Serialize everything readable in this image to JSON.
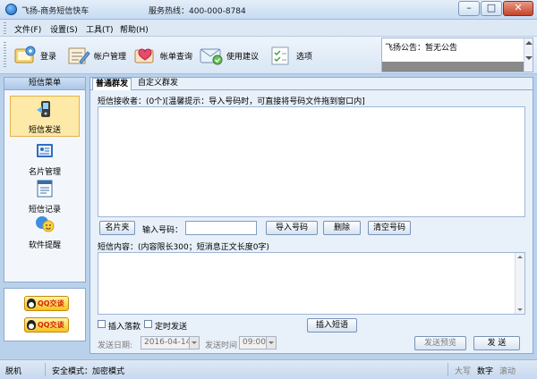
{
  "window": {
    "title": "飞扬-商务短信快车",
    "hotline": "服务热线：400-000-8784"
  },
  "menu": [
    "文件(F)",
    "设置(S)",
    "工具(T)",
    "帮助(H)"
  ],
  "toolbar": [
    {
      "label": "登录",
      "icon": "login-icon"
    },
    {
      "label": "帐户管理",
      "icon": "account-icon"
    },
    {
      "label": "帐单查询",
      "icon": "bill-icon"
    },
    {
      "label": "使用建议",
      "icon": "suggestion-icon"
    },
    {
      "label": "选项",
      "icon": "options-icon"
    }
  ],
  "notice": {
    "text": "飞扬公告：暂无公告"
  },
  "sidebar": {
    "title": "短信菜单",
    "items": [
      {
        "label": "短信发送",
        "icon": "sms-send-icon",
        "active": true
      },
      {
        "label": "名片管理",
        "icon": "card-icon",
        "active": false
      },
      {
        "label": "短信记录",
        "icon": "record-icon",
        "active": false
      },
      {
        "label": "软件提醒",
        "icon": "reminder-icon",
        "active": false
      }
    ]
  },
  "qq": [
    "QQ交谈",
    "QQ交谈"
  ],
  "tabs": [
    "普通群发",
    "自定义群发"
  ],
  "recipients": {
    "label": "短信接收者：(0个)[温馨提示：导入号码时，可直接将号码文件拖到窗口内]",
    "card_button": "名片夹",
    "input_label": "输入号码：",
    "input_value": "",
    "import_button": "导入号码",
    "delete_button": "删除",
    "clear_button": "清空号码"
  },
  "content": {
    "label": "短信内容：(内容限长300；短消息正文长度0字)",
    "insert_sign": "插入落款",
    "timed_send": "定时发送",
    "insert_phrase": "插入短语",
    "send_date_label": "发送日期:",
    "send_date": "2016-04-14",
    "send_time_label": "发送时间",
    "send_time": "09:00",
    "preview_button": "发送预览",
    "send_button": "发 送"
  },
  "status": {
    "offline": "脱机",
    "security": "安全模式：加密模式",
    "caps": "大写",
    "num": "数字",
    "scroll": "滚动"
  },
  "colors": {
    "accent": "#b9d1ea",
    "active_item": "#fde9a8"
  }
}
